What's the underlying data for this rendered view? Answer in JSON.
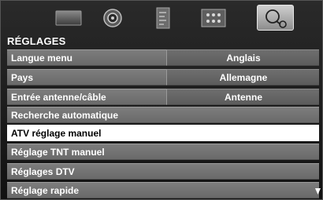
{
  "menu_tabs": [
    {
      "name": "picture",
      "icon": "picture-icon",
      "active": false
    },
    {
      "name": "sound",
      "icon": "speaker-icon",
      "active": false
    },
    {
      "name": "preferences",
      "icon": "document-icon",
      "active": false
    },
    {
      "name": "features",
      "icon": "grid-icon",
      "active": false
    },
    {
      "name": "setup",
      "icon": "setup-icon",
      "active": true
    }
  ],
  "title": "RÉGLAGES",
  "menu": {
    "rows": [
      {
        "label": "Langue menu",
        "value": "Anglais"
      },
      {
        "label": "Pays",
        "value": "Allemagne"
      },
      {
        "label": "Entrée antenne/câble",
        "value": "Antenne"
      },
      {
        "label": "Recherche automatique"
      },
      {
        "label": "ATV réglage manuel",
        "selected": true
      },
      {
        "label": "Réglage TNT manuel"
      },
      {
        "label": "Réglages DTV"
      },
      {
        "label": "Réglage rapide"
      }
    ]
  },
  "colors": {
    "background": "#1c1c1c",
    "row": "#747474",
    "value_cell": "#656565",
    "selected_row": "#ffffff",
    "text": "#ffffff"
  },
  "scroll_indicator": "down-arrow-icon"
}
